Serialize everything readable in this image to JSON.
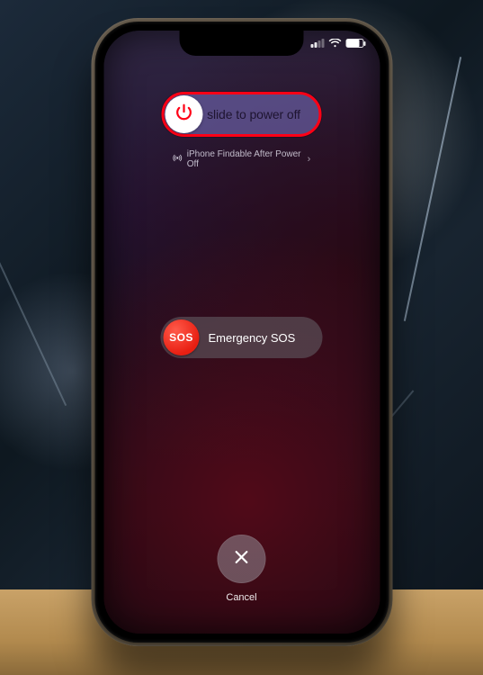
{
  "statusBar": {
    "signalBars": 2,
    "wifi": true,
    "batteryPct": 82
  },
  "powerOff": {
    "label": "slide to power off"
  },
  "findable": {
    "text": "iPhone Findable After Power Off"
  },
  "sos": {
    "knobText": "SOS",
    "label": "Emergency SOS"
  },
  "cancel": {
    "label": "Cancel"
  },
  "colors": {
    "highlightRing": "#ff0016",
    "sosRed": "#e81f12"
  }
}
